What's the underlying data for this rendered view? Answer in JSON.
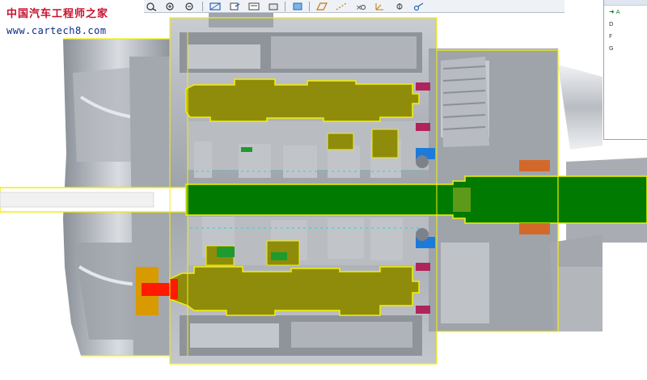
{
  "watermark": {
    "title": "中国汽车工程师之家",
    "url": "www.cartech8.com"
  },
  "toolbar": {
    "buttons": [
      {
        "icon": "zoom-window-icon"
      },
      {
        "icon": "zoom-in-icon"
      },
      {
        "icon": "zoom-out-icon"
      },
      {
        "icon": "refit-icon"
      },
      {
        "icon": "orient-icon"
      },
      {
        "icon": "saved-views-icon"
      },
      {
        "icon": "view-manager-icon"
      },
      {
        "icon": "shading-icon"
      },
      {
        "icon": "datum-planes-icon"
      },
      {
        "icon": "datum-axes-icon"
      },
      {
        "icon": "datum-points-icon"
      },
      {
        "icon": "coordinate-systems-icon"
      },
      {
        "icon": "annotations-icon"
      },
      {
        "icon": "spin-center-icon"
      }
    ]
  },
  "panel": {
    "items": [
      {
        "label": "A",
        "active": true
      },
      {
        "label": "D",
        "active": false
      },
      {
        "label": "F",
        "active": false
      },
      {
        "label": "G",
        "active": false
      }
    ]
  },
  "colors": {
    "housing": "#a7abb2",
    "housing_light": "#d7dade",
    "housing_dark": "#6f747c",
    "countershaft": "#8f8c0b",
    "countershaft_light": "#b5b21e",
    "mainshaft": "#007a00",
    "mainshaft_dark": "#005a00",
    "section_outline": "#f4f000",
    "highlight_red": "#ff1a00",
    "bearing_blue": "#1e7ad8",
    "seal_magenta": "#b0245c",
    "bearing_orange": "#d2692a",
    "synchro_green": "#1f9a2e"
  }
}
